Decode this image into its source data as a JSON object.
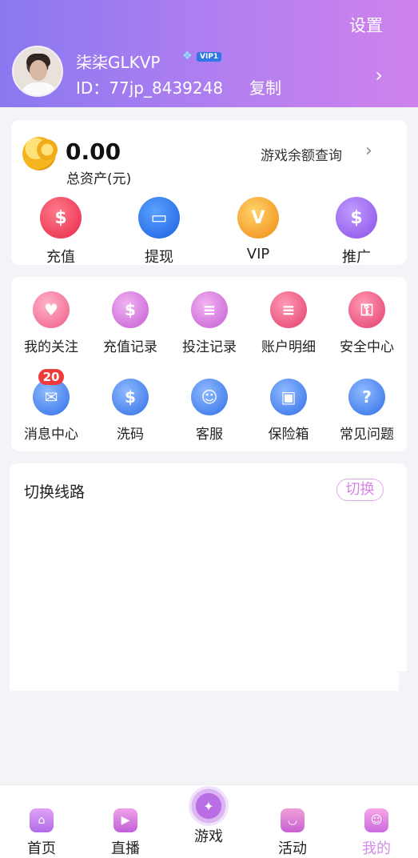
{
  "header": {
    "settings_label": "设置",
    "username": "柒柒GLKVP",
    "vip_label": "VIP1",
    "uid_text": "ID：77jp_8439248",
    "copy_label": "复制",
    "chevron": "›"
  },
  "wallet": {
    "balance": "0.00",
    "total_label": "总资产(元)",
    "query_label": "游戏余额查询",
    "query_chevron": "›",
    "actions": [
      {
        "label": "充值",
        "icon": "money-bag-icon",
        "glyph": "$"
      },
      {
        "label": "提现",
        "icon": "card-icon",
        "glyph": "▭"
      },
      {
        "label": "VIP",
        "icon": "vip-icon",
        "glyph": "V"
      },
      {
        "label": "推广",
        "icon": "promo-bag-icon",
        "glyph": "$"
      }
    ]
  },
  "menu": {
    "items": [
      {
        "label": "我的关注",
        "icon": "heart-icon",
        "glyph": "♥"
      },
      {
        "label": "充值记录",
        "icon": "recharge-record-icon",
        "glyph": "$"
      },
      {
        "label": "投注记录",
        "icon": "bet-record-icon",
        "glyph": "≡"
      },
      {
        "label": "账户明细",
        "icon": "account-detail-icon",
        "glyph": "≡"
      },
      {
        "label": "安全中心",
        "icon": "security-icon",
        "glyph": "⚿"
      },
      {
        "label": "消息中心",
        "icon": "message-icon",
        "glyph": "✉",
        "badge": "20"
      },
      {
        "label": "洗码",
        "icon": "chip-icon",
        "glyph": "$"
      },
      {
        "label": "客服",
        "icon": "customer-service-icon",
        "glyph": "☺"
      },
      {
        "label": "保险箱",
        "icon": "safe-icon",
        "glyph": "▣"
      },
      {
        "label": "常见问题",
        "icon": "question-icon",
        "glyph": "?"
      }
    ]
  },
  "line_switch": {
    "title": "切换线路",
    "switch_label": "切换"
  },
  "tabbar": {
    "tabs": [
      {
        "label": "首页",
        "icon": "home-icon"
      },
      {
        "label": "直播",
        "icon": "live-icon"
      },
      {
        "label": "游戏",
        "icon": "gamepad-icon"
      },
      {
        "label": "活动",
        "icon": "activity-icon"
      },
      {
        "label": "我的",
        "icon": "me-icon"
      }
    ],
    "active": "我的"
  },
  "colors": {
    "header_gradient_start": "#8a78f0",
    "header_gradient_end": "#cf82ec",
    "accent": "#d585e6",
    "badge_red": "#ef3b3b"
  }
}
